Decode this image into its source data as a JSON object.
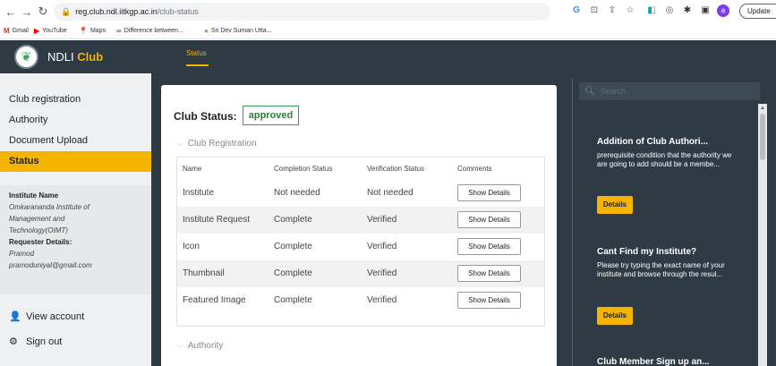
{
  "browser": {
    "url_host": "reg.club.ndl.iitkgp.ac.in",
    "url_path": "/club-status",
    "update_label": "Update",
    "bookmarks": [
      {
        "label": "Gmail"
      },
      {
        "label": "YouTube"
      },
      {
        "label": "Maps"
      },
      {
        "label": "Difference between..."
      },
      {
        "label": "Sri Dev Suman Utta..."
      }
    ],
    "profile_initial": "a"
  },
  "brand": {
    "name": "NDLI",
    "accent": "Club"
  },
  "sidebar": {
    "items": [
      {
        "label": "Club registration"
      },
      {
        "label": "Authority"
      },
      {
        "label": "Document Upload"
      },
      {
        "label": "Status"
      }
    ],
    "institute_name_label": "Institute Name",
    "institute_name_lines": [
      "Omkarananda Institute of",
      "Management and",
      "Technology(OIMT)"
    ],
    "requester_label": "Requester Details:",
    "requester_name": "Pramod",
    "requester_email": "pramoduniyal@gmail.com",
    "view_account_label": "View account",
    "sign_out_label": "Sign out"
  },
  "topnav": {
    "tab_label": "Status"
  },
  "status_card": {
    "club_status_label": "Club Status:",
    "club_status_value": "approved",
    "section_registration": "Club Registration",
    "section_authority": "Authority",
    "columns": [
      "Name",
      "Completion Status",
      "Verification Status",
      "Comments"
    ],
    "rows": [
      {
        "name": "Institute",
        "completion": "Not needed",
        "verification": "Not needed",
        "action": "Show Details"
      },
      {
        "name": "Institute Request",
        "completion": "Complete",
        "verification": "Verified",
        "action": "Show Details"
      },
      {
        "name": "Icon",
        "completion": "Complete",
        "verification": "Verified",
        "action": "Show Details"
      },
      {
        "name": "Thumbnail",
        "completion": "Complete",
        "verification": "Verified",
        "action": "Show Details"
      },
      {
        "name": "Featured Image",
        "completion": "Complete",
        "verification": "Verified",
        "action": "Show Details"
      }
    ]
  },
  "right_panel": {
    "search_placeholder": "Search",
    "notices": [
      {
        "title": "Addition of Club Authori...",
        "body": "prerequisite condition that the authority we are going to add should be a membe...",
        "button": "Details"
      },
      {
        "title": "Cant Find my Institute?",
        "body": "Please try typing the exact name of your institute and browse through the resul...",
        "button": "Details"
      },
      {
        "title": "Club Member Sign up an...",
        "body": "",
        "button": ""
      }
    ]
  },
  "colors": {
    "accent": "#f5b400",
    "dark": "#2e3b45",
    "approved": "#2e7d32"
  }
}
